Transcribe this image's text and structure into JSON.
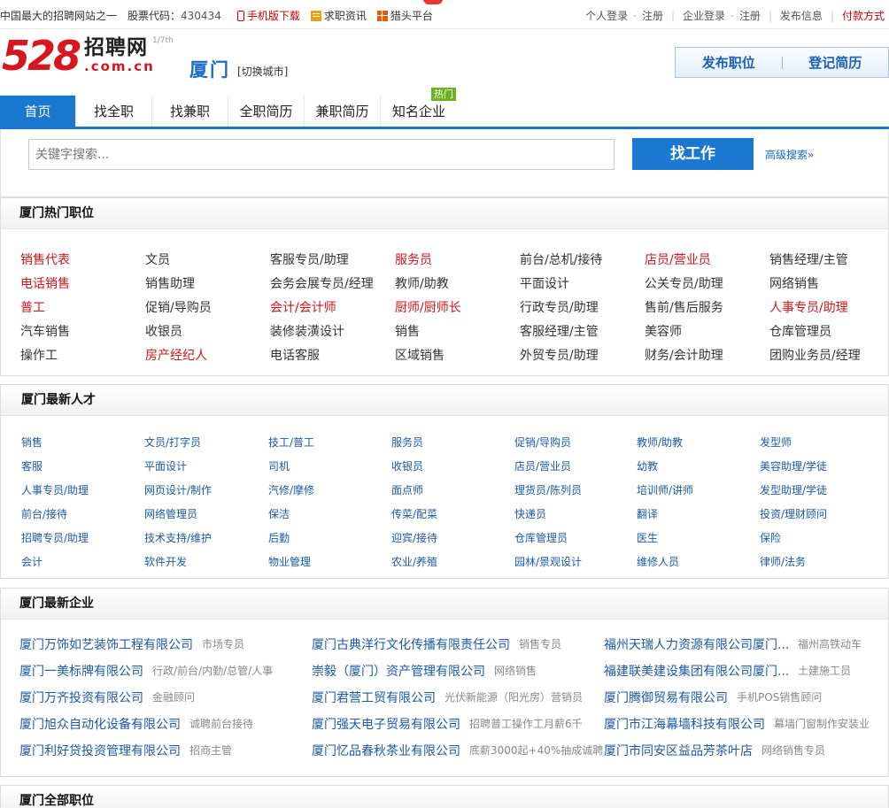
{
  "topbar": {
    "slogan": "中国最大的招聘网站之一",
    "stock_label": "股票代码：",
    "stock_code": "430434",
    "mobile": "手机版下载",
    "news": "求职资讯",
    "hunter": "猎头平台",
    "personal_login": "个人登录",
    "register1": "注册",
    "company_login": "企业登录",
    "register2": "注册",
    "publish": "发布信息",
    "pay": "付款方式",
    "dot": "·",
    "sep": "|"
  },
  "header": {
    "logo_num": "528",
    "logo_cn": "招聘网",
    "logo_domain": ".com.cn",
    "logo_rank": "1/7th",
    "city": "厦门",
    "switch_city": "[切换城市]",
    "post_job": "发布职位",
    "register_resume": "登记简历"
  },
  "nav": {
    "tabs": [
      "首页",
      "找全职",
      "找兼职",
      "全职简历",
      "兼职简历",
      "知名企业"
    ],
    "hot": "热门"
  },
  "search": {
    "placeholder": "关键字搜索...",
    "button": "找工作",
    "advanced": "高级搜索"
  },
  "colors": {
    "accent": "#1b78d0",
    "red": "#d0141a",
    "link": "#1b5aa6"
  },
  "hot_jobs": {
    "title": "厦门热门职位",
    "rows": [
      [
        [
          "销售代表",
          1
        ],
        [
          "文员",
          0
        ],
        [
          "客服专员/助理",
          0
        ],
        [
          "服务员",
          1
        ],
        [
          "前台/总机/接待",
          0
        ],
        [
          "店员/营业员",
          1
        ],
        [
          "销售经理/主管",
          0
        ]
      ],
      [
        [
          "电话销售",
          1
        ],
        [
          "销售助理",
          0
        ],
        [
          "会务会展专员/经理",
          0
        ],
        [
          "教师/助教",
          0
        ],
        [
          "平面设计",
          0
        ],
        [
          "公关专员/助理",
          0
        ],
        [
          "网络销售",
          0
        ]
      ],
      [
        [
          "普工",
          1
        ],
        [
          "促销/导购员",
          0
        ],
        [
          "会计/会计师",
          1
        ],
        [
          "厨师/厨师长",
          1
        ],
        [
          "行政专员/助理",
          0
        ],
        [
          "售前/售后服务",
          0
        ],
        [
          "人事专员/助理",
          1
        ]
      ],
      [
        [
          "汽车销售",
          0
        ],
        [
          "收银员",
          0
        ],
        [
          "装修装潢设计",
          0
        ],
        [
          "销售",
          0
        ],
        [
          "客服经理/主管",
          0
        ],
        [
          "美容师",
          0
        ],
        [
          "仓库管理员",
          0
        ]
      ],
      [
        [
          "操作工",
          0
        ],
        [
          "房产经纪人",
          1
        ],
        [
          "电话客服",
          0
        ],
        [
          "区域销售",
          0
        ],
        [
          "外贸专员/助理",
          0
        ],
        [
          "财务/会计助理",
          0
        ],
        [
          "团购业务员/经理",
          0
        ]
      ]
    ]
  },
  "talents": {
    "title": "厦门最新人才",
    "rows": [
      [
        "销售",
        "文员/打字员",
        "技工/普工",
        "服务员",
        "促销/导购员",
        "教师/助教",
        "发型师"
      ],
      [
        "客服",
        "平面设计",
        "司机",
        "收银员",
        "店员/营业员",
        "幼教",
        "美容助理/学徒"
      ],
      [
        "人事专员/助理",
        "网页设计/制作",
        "汽修/摩修",
        "面点师",
        "理货员/陈列员",
        "培训师/讲师",
        "发型助理/学徒"
      ],
      [
        "前台/接待",
        "网络管理员",
        "保洁",
        "传菜/配菜",
        "快递员",
        "翻译",
        "投资/理财顾问"
      ],
      [
        "招聘专员/助理",
        "技术支持/维护",
        "后勤",
        "迎宾/接待",
        "仓库管理员",
        "医生",
        "保险"
      ],
      [
        "会计",
        "软件开发",
        "物业管理",
        "农业/养殖",
        "园林/景观设计",
        "维修人员",
        "律师/法务"
      ]
    ]
  },
  "companies": {
    "title": "厦门最新企业",
    "rows": [
      [
        [
          "厦门万饰如艺装饰工程有限公司",
          "市场专员"
        ],
        [
          "厦门古典洋行文化传播有限责任公司",
          "销售专员"
        ],
        [
          "福州天瑞人力资源有限公司厦门...",
          "福州高铁动车"
        ]
      ],
      [
        [
          "厦门一美标牌有限公司",
          "行政/前台/内勤/总管/人事"
        ],
        [
          "崇毅（厦门）资产管理有限公司",
          "网络销售"
        ],
        [
          "福建联美建设集团有限公司厦门...",
          "土建施工员"
        ]
      ],
      [
        [
          "厦门万齐投资有限公司",
          "金融顾问"
        ],
        [
          "厦门君营工贸有限公司",
          "光伏新能源（阳光房）营销员"
        ],
        [
          "厦门腾御贸易有限公司",
          "手机POS销售顾问"
        ]
      ],
      [
        [
          "厦门旭众自动化设备有限公司",
          "诚聘前台接待"
        ],
        [
          "厦门强天电子贸易有限公司",
          "招聘普工操作工月薪6千"
        ],
        [
          "厦门市江海幕墙科技有限公司",
          "幕墙门窗制作安装业"
        ]
      ],
      [
        [
          "厦门利好贷投资管理有限公司",
          "招商主管"
        ],
        [
          "厦门忆品春秋茶业有限公司",
          "底薪3000起+40%抽成诚聘"
        ],
        [
          "厦门市同安区益品芳茶叶店",
          "网络销售专员"
        ]
      ]
    ]
  },
  "all_jobs": {
    "title": "厦门全部职位"
  }
}
